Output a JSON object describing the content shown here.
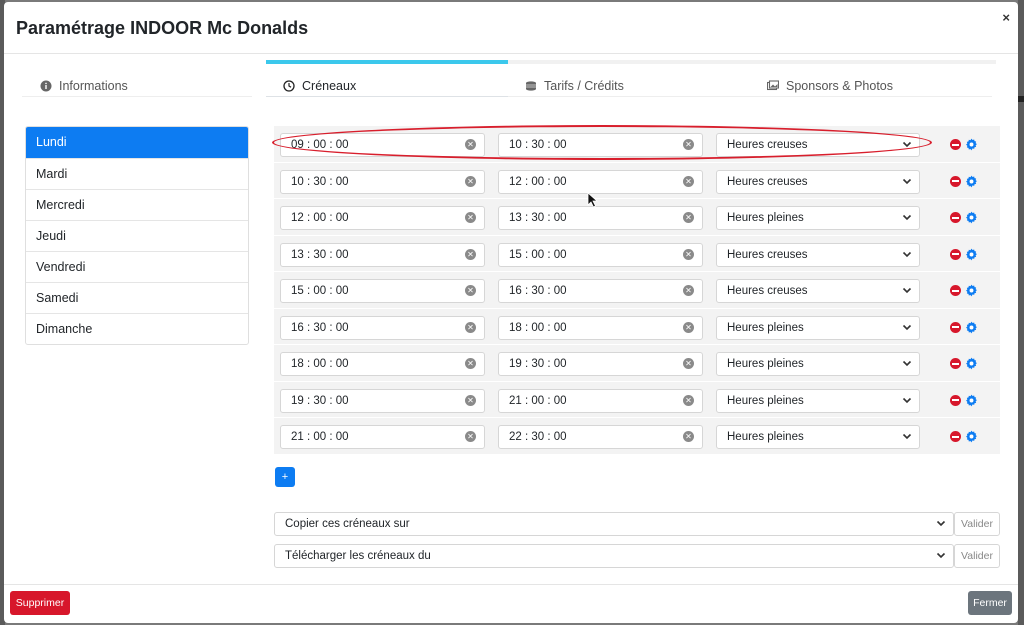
{
  "modal": {
    "title": "Paramétrage INDOOR Mc Donalds",
    "close_glyph": "×"
  },
  "tabs": [
    {
      "label": "Informations",
      "icon": "info-circle-icon",
      "active": false
    },
    {
      "label": "Créneaux",
      "icon": "clock-icon",
      "active": true
    },
    {
      "label": "Tarifs / Crédits",
      "icon": "coins-icon",
      "active": false
    },
    {
      "label": "Sponsors & Photos",
      "icon": "images-icon",
      "active": false
    }
  ],
  "days": [
    {
      "label": "Lundi",
      "active": true
    },
    {
      "label": "Mardi"
    },
    {
      "label": "Mercredi"
    },
    {
      "label": "Jeudi"
    },
    {
      "label": "Vendredi"
    },
    {
      "label": "Samedi"
    },
    {
      "label": "Dimanche"
    }
  ],
  "slots": [
    {
      "start": "09 : 00 : 00",
      "end": "10 : 30 : 00",
      "type": "Heures creuses"
    },
    {
      "start": "10 : 30 : 00",
      "end": "12 : 00 : 00",
      "type": "Heures creuses"
    },
    {
      "start": "12 : 00 : 00",
      "end": "13 : 30 : 00",
      "type": "Heures pleines"
    },
    {
      "start": "13 : 30 : 00",
      "end": "15 : 00 : 00",
      "type": "Heures creuses"
    },
    {
      "start": "15 : 00 : 00",
      "end": "16 : 30 : 00",
      "type": "Heures creuses"
    },
    {
      "start": "16 : 30 : 00",
      "end": "18 : 00 : 00",
      "type": "Heures pleines"
    },
    {
      "start": "18 : 00 : 00",
      "end": "19 : 30 : 00",
      "type": "Heures pleines"
    },
    {
      "start": "19 : 30 : 00",
      "end": "21 : 00 : 00",
      "type": "Heures pleines"
    },
    {
      "start": "21 : 00 : 00",
      "end": "22 : 30 : 00",
      "type": "Heures pleines"
    }
  ],
  "add_label": "+",
  "copy": {
    "label": "Copier ces créneaux sur",
    "button": "Valider"
  },
  "download": {
    "label": "Télécharger les créneaux du",
    "button": "Valider"
  },
  "footer": {
    "delete_label": "Supprimer",
    "close_label": "Fermer"
  },
  "colors": {
    "primary": "#0d7cf2",
    "danger": "#d7172b",
    "tab_accent": "#3bc8ec",
    "secondary": "#6c757d",
    "annotation": "#d81e2c"
  }
}
